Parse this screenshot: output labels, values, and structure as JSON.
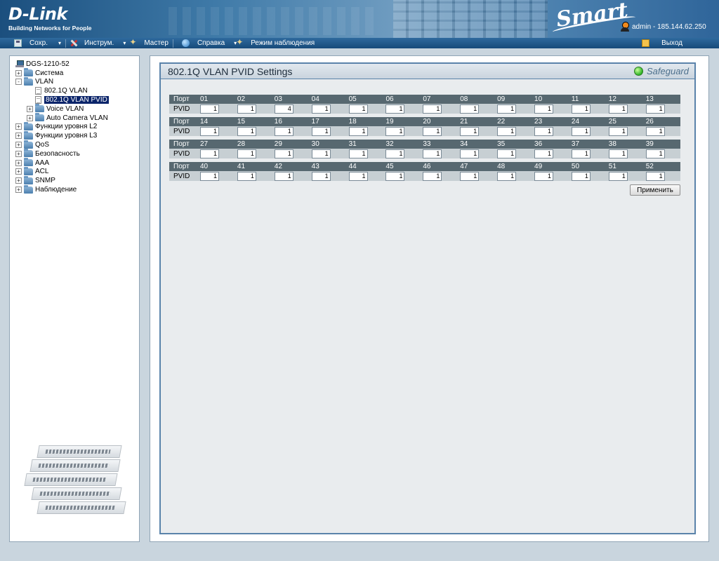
{
  "header": {
    "logo_main": "D-Link",
    "logo_sub": "Building Networks for People",
    "smart_logo": "Smart",
    "user_info": "admin - 185.144.62.250"
  },
  "toolbar": {
    "save": "Сохр.",
    "tools": "Инструм.",
    "wizard": "Мастер",
    "help": "Справка",
    "monitor": "Режим наблюдения",
    "logout": "Выход"
  },
  "tree": {
    "root": "DGS-1210-52",
    "items": [
      {
        "label": "Система",
        "level": 0,
        "type": "folder",
        "exp": "+"
      },
      {
        "label": "VLAN",
        "level": 0,
        "type": "folder",
        "exp": "−"
      },
      {
        "label": "802.1Q VLAN",
        "level": 1,
        "type": "doc",
        "exp": ""
      },
      {
        "label": "802.1Q VLAN PVID",
        "level": 1,
        "type": "doc",
        "exp": "",
        "selected": true
      },
      {
        "label": "Voice VLAN",
        "level": 1,
        "type": "folder",
        "exp": "+"
      },
      {
        "label": "Auto Camera VLAN",
        "level": 1,
        "type": "folder",
        "exp": "+"
      },
      {
        "label": "Функции уровня L2",
        "level": 0,
        "type": "folder",
        "exp": "+"
      },
      {
        "label": "Функции уровня L3",
        "level": 0,
        "type": "folder",
        "exp": "+"
      },
      {
        "label": "QoS",
        "level": 0,
        "type": "folder",
        "exp": "+"
      },
      {
        "label": "Безопасность",
        "level": 0,
        "type": "folder",
        "exp": "+"
      },
      {
        "label": "AAA",
        "level": 0,
        "type": "folder",
        "exp": "+"
      },
      {
        "label": "ACL",
        "level": 0,
        "type": "folder",
        "exp": "+"
      },
      {
        "label": "SNMP",
        "level": 0,
        "type": "folder",
        "exp": "+"
      },
      {
        "label": "Наблюдение",
        "level": 0,
        "type": "folder",
        "exp": "+"
      }
    ]
  },
  "main": {
    "title": "802.1Q VLAN PVID Settings",
    "safeguard": "Safeguard",
    "port_label": "Порт",
    "pvid_label": "PVID",
    "apply": "Применить",
    "blocks": [
      {
        "ports": [
          "01",
          "02",
          "03",
          "04",
          "05",
          "06",
          "07",
          "08",
          "09",
          "10",
          "11",
          "12",
          "13"
        ],
        "pvids": [
          "1",
          "1",
          "4",
          "1",
          "1",
          "1",
          "1",
          "1",
          "1",
          "1",
          "1",
          "1",
          "1"
        ]
      },
      {
        "ports": [
          "14",
          "15",
          "16",
          "17",
          "18",
          "19",
          "20",
          "21",
          "22",
          "23",
          "24",
          "25",
          "26"
        ],
        "pvids": [
          "1",
          "1",
          "1",
          "1",
          "1",
          "1",
          "1",
          "1",
          "1",
          "1",
          "1",
          "1",
          "1"
        ]
      },
      {
        "ports": [
          "27",
          "28",
          "29",
          "30",
          "31",
          "32",
          "33",
          "34",
          "35",
          "36",
          "37",
          "38",
          "39"
        ],
        "pvids": [
          "1",
          "1",
          "1",
          "1",
          "1",
          "1",
          "1",
          "1",
          "1",
          "1",
          "1",
          "1",
          "1"
        ]
      },
      {
        "ports": [
          "40",
          "41",
          "42",
          "43",
          "44",
          "45",
          "46",
          "47",
          "48",
          "49",
          "50",
          "51",
          "52"
        ],
        "pvids": [
          "1",
          "1",
          "1",
          "1",
          "1",
          "1",
          "1",
          "1",
          "1",
          "1",
          "1",
          "1",
          "1"
        ]
      }
    ]
  }
}
